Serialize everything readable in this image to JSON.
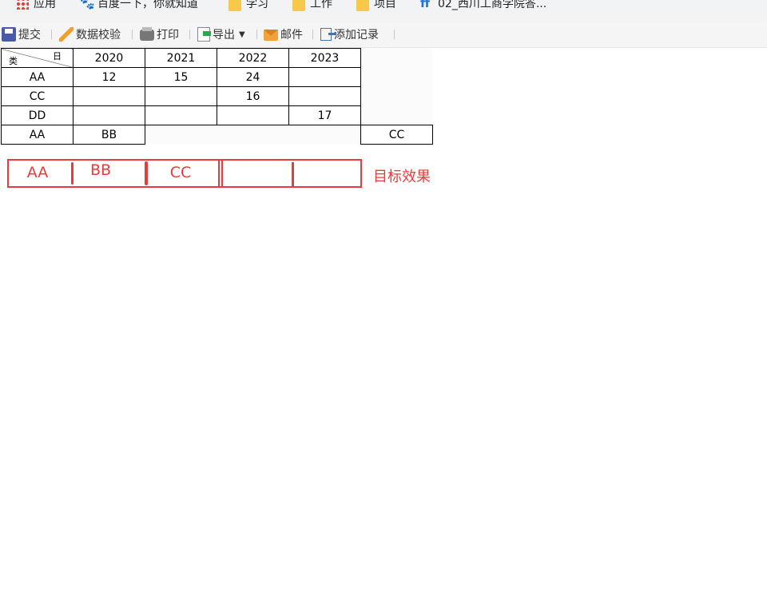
{
  "bookmarks": [
    {
      "icon": "apps-icon",
      "label": "应用"
    },
    {
      "icon": "baidu-paw-icon",
      "label": "百度一下，你就知道"
    },
    {
      "icon": "folder-icon",
      "label": "学习"
    },
    {
      "icon": "folder-icon",
      "label": "工作"
    },
    {
      "icon": "folder-icon",
      "label": "项目"
    },
    {
      "icon": "site-favicon",
      "label": "02_西川工商学院答..."
    }
  ],
  "toolbar": {
    "submit": "提交",
    "validate": "数据校验",
    "print": "打印",
    "export": "导出",
    "mail": "邮件",
    "add_record": "添加记录"
  },
  "table": {
    "corner_top": "日",
    "corner_bottom": "类",
    "years": [
      "2020",
      "2021",
      "2022",
      "2023"
    ],
    "rows": [
      {
        "label": "AA",
        "cells": [
          "12",
          "15",
          "24",
          ""
        ]
      },
      {
        "label": "CC",
        "cells": [
          "",
          "",
          "16",
          ""
        ]
      },
      {
        "label": "DD",
        "cells": [
          "",
          "",
          "",
          "17"
        ]
      }
    ],
    "extra_row": {
      "c1": "AA",
      "c2": "BB",
      "c6": "CC"
    }
  },
  "annotation": {
    "cells": [
      "AA",
      "BB",
      "CC"
    ],
    "label": "目标效果",
    "color": "#e83c3c"
  }
}
